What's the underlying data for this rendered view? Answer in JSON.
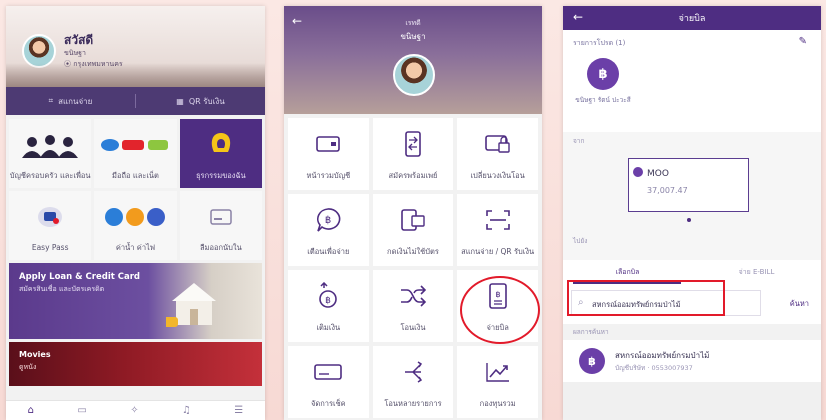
{
  "phone1": {
    "user_name": "สวัสดี",
    "user_sub": "ขนิษฐา",
    "user_location": "กรุงเทพมหานคร",
    "scan_label": "สแกนจ่าย",
    "qr_label": "QR รับเงิน",
    "tiles": [
      {
        "label": "บัญชีครอบครัว และเพื่อน",
        "icon": "family-icon"
      },
      {
        "label": "มือถือ และเน็ต",
        "icon": "mobile-carriers-icon"
      },
      {
        "label": "ธุรกรรมของฉัน",
        "icon": "bank-logo-icon"
      },
      {
        "label": "Easy Pass",
        "icon": "easy-pass-icon"
      },
      {
        "label": "ค่าน้ำ ค่าไฟ",
        "icon": "utility-icon"
      },
      {
        "label": "ลืมออกนับใน",
        "icon": "card-icon"
      }
    ],
    "loan_title": "Apply Loan & Credit Card",
    "loan_sub": "สมัครสินเชื่อ และบัตรเครดิต",
    "movies_title": "Movies",
    "movies_sub": "ดูหนัง"
  },
  "phone2": {
    "header_small": "เรทดี",
    "header_name": "ขนิษฐา",
    "tiles": [
      {
        "label": "หน้ารวมบัญชี",
        "icon": "account-card-icon"
      },
      {
        "label": "สมัครพร้อมเพย์",
        "icon": "transfer-phone-icon"
      },
      {
        "label": "เปลี่ยนวงเงินโอน",
        "icon": "limit-card-icon"
      },
      {
        "label": "เตือนเพื่อจ่าย",
        "icon": "baht-bubble-icon"
      },
      {
        "label": "กดเงินไม่ใช้บัตร",
        "icon": "cardless-icon"
      },
      {
        "label": "สแกนจ่าย / QR รับเงิน",
        "icon": "scan-icon"
      },
      {
        "label": "เติมเงิน",
        "icon": "topup-icon"
      },
      {
        "label": "โอนเงิน",
        "icon": "shuffle-transfer-icon"
      },
      {
        "label": "จ่ายบิล",
        "icon": "bill-icon"
      },
      {
        "label": "จัดการเช็ค",
        "icon": "cheque-icon"
      },
      {
        "label": "โอนหลายรายการ",
        "icon": "multi-transfer-icon"
      },
      {
        "label": "กองทุนรวม",
        "icon": "fund-chart-icon"
      }
    ]
  },
  "phone3": {
    "title": "จ่ายบิล",
    "favorites_label": "รายการโปรด (1)",
    "favorite_name": "ขนิษฐา รัตน์ ปะวะสี",
    "from_label": "จาก",
    "account_name": "MOO",
    "account_balance": "37,007.47",
    "to_label": "ไปยัง",
    "tab_bill": "เลือกบิล",
    "tab_ebill": "จ่าย E-BILL",
    "search_value": "สหกรณ์ออมทรัพย์กรมป่าไม้",
    "search_button": "ค้นหา",
    "results_label": "ผลการค้นหา",
    "result_name": "สหกรณ์ออมทรัพย์กรมป่าไม้",
    "result_sub": "บัญชีบริษัท · 0553007937"
  }
}
